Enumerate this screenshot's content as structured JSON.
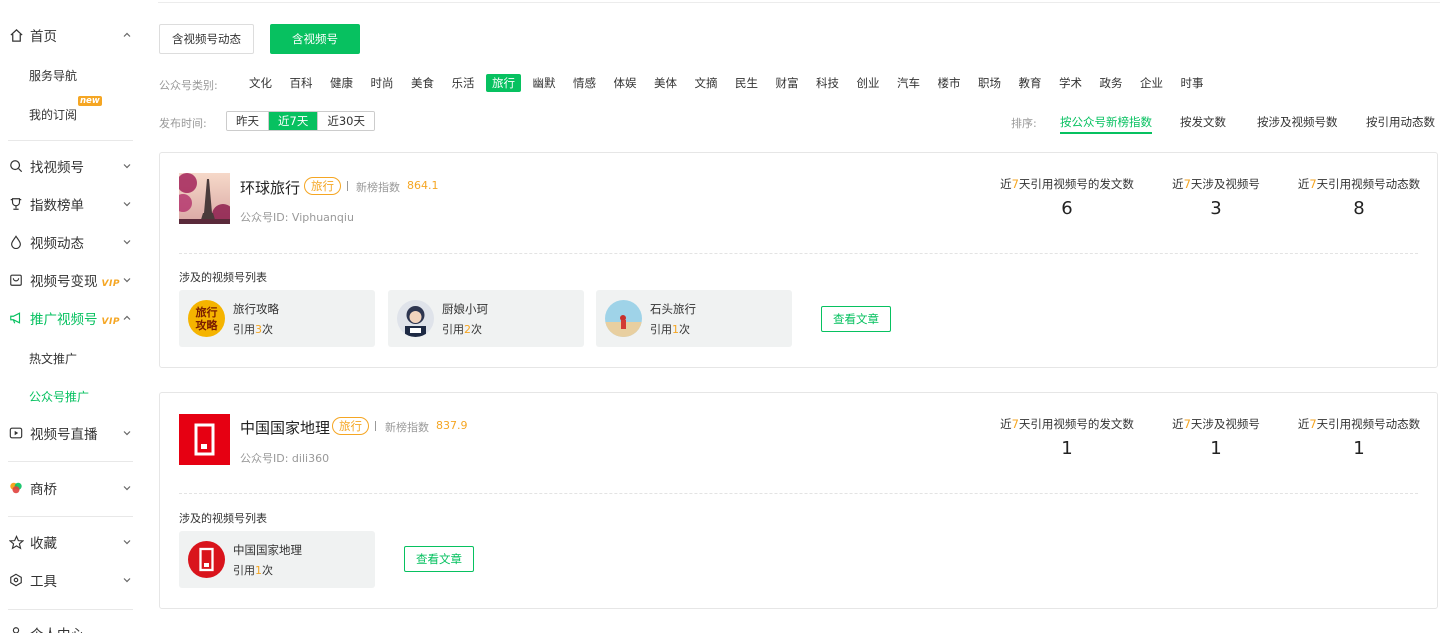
{
  "sidebar": {
    "home": "首页",
    "service_nav": "服务导航",
    "my_subscription": "我的订阅",
    "new_tag": "new",
    "find_channel": "找视频号",
    "index_rank": "指数榜单",
    "video_dynamic": "视频动态",
    "monetize": "视频号变现",
    "promote": "推广视频号",
    "vip": "VIP",
    "hot_promote": "热文推广",
    "official_promote": "公众号推广",
    "live": "视频号直播",
    "shangqiao": "商桥",
    "favorites": "收藏",
    "tools": "工具",
    "personal_center": "个人中心"
  },
  "tabs": [
    {
      "label": "含视频号动态",
      "active": false
    },
    {
      "label": "含视频号",
      "active": true
    }
  ],
  "filters": {
    "category_label": "公众号类别:",
    "categories": [
      "文化",
      "百科",
      "健康",
      "时尚",
      "美食",
      "乐活",
      "旅行",
      "幽默",
      "情感",
      "体娱",
      "美体",
      "文摘",
      "民生",
      "财富",
      "科技",
      "创业",
      "汽车",
      "楼市",
      "职场",
      "教育",
      "学术",
      "政务",
      "企业",
      "时事"
    ],
    "active_category": "旅行",
    "time_label": "发布时间:",
    "time_options": [
      "昨天",
      "近7天",
      "近30天"
    ],
    "active_time": "近7天",
    "sort_label": "排序:",
    "sort_options": [
      "按公众号新榜指数",
      "按发文数",
      "按涉及视频号数",
      "按引用动态数"
    ],
    "active_sort": "按公众号新榜指数"
  },
  "stat_labels": {
    "prefix": "近",
    "days": "7",
    "s1_suffix": "天引用视频号的发文数",
    "s2_suffix": "天涉及视频号",
    "s3_suffix": "天引用视频号动态数"
  },
  "common": {
    "index_label": "新榜指数",
    "id_prefix": "公众号ID: ",
    "section_title": "涉及的视频号列表",
    "cite_prefix": "引用",
    "cite_suffix": "次",
    "view_articles": "查看文章"
  },
  "accounts": [
    {
      "name": "环球旅行",
      "tag": "旅行",
      "index": "864.1",
      "id": "Viphuanqiu",
      "stats": [
        "6",
        "3",
        "8"
      ],
      "channels": [
        {
          "name": "旅行攻略",
          "count": "3",
          "avatar_text": "旅行攻略"
        },
        {
          "name": "厨娘小珂",
          "count": "2"
        },
        {
          "name": "石头旅行",
          "count": "1"
        }
      ]
    },
    {
      "name": "中国国家地理",
      "tag": "旅行",
      "index": "837.9",
      "id": "dili360",
      "stats": [
        "1",
        "1",
        "1"
      ],
      "channels": [
        {
          "name": "中国国家地理",
          "count": "1"
        }
      ]
    }
  ],
  "colors": {
    "accent": "#07c160",
    "highlight": "#f5a623"
  }
}
